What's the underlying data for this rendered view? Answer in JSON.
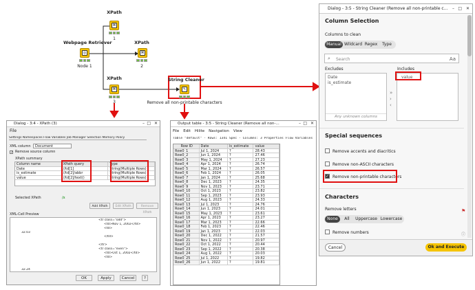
{
  "workflow": {
    "xpath1": {
      "title": "XPath",
      "label": "1"
    },
    "webpage": {
      "title": "Webpage Retriever",
      "label": "Node 1"
    },
    "xpath2": {
      "title": "XPath",
      "label": "2"
    },
    "xpath3": {
      "title": "XPath",
      "label": "3"
    },
    "cleaner": {
      "title": "String Cleaner",
      "label": "Remove all non-printable characters"
    }
  },
  "xpath_dialog": {
    "title": "Dialog - 3:4 - XPath (3)",
    "menu": "File",
    "tabs": "Settings  Namespaces  Flow Variables  Job Manager Selection  Memory Policy",
    "xml_column_label": "XML column",
    "xml_column_value": "Document",
    "remove_source": "Remove source column",
    "summary_label": "XPath summary",
    "headers": [
      "Column name",
      "XPath query",
      "Type"
    ],
    "rows": [
      [
        "Date",
        "//td[1]",
        "String(Multiple Rows)"
      ],
      [
        "is_estimate",
        "//td[2]/abbr",
        "String(Multiple Rows)"
      ],
      [
        "value",
        "//td[2]/text()",
        "String(Multiple Rows)"
      ]
    ],
    "selected_label": "Selected XPath",
    "selected_value": "/x",
    "add_button": "Add XPath",
    "edit_button": "Edit XPath",
    "remove_button": "Remove XPath",
    "preview_label": "XML-Cell Preview",
    "preview_lines": [
      "<tr class=\"odd\">",
      "<td>Nov 1, 2002</td>",
      "<td>",
      "32.03",
      "</td>",
      "</tr>",
      "<tr class=\"even\">",
      "<td>Oct 1, 2002</td>",
      "<td>",
      "32.24"
    ],
    "ok": "OK",
    "apply": "Apply",
    "cancel": "Cancel"
  },
  "output_table": {
    "title": "Output table - 3:5 - String Cleaner (Remove all non-...",
    "menu": [
      "File",
      "Edit",
      "Hilite",
      "Navigation",
      "View"
    ],
    "info": "Table \"default\" - Rows: 1341  Spec - Columns: 3  Properties  Flow Variables",
    "headers": [
      "Row ID",
      "Date",
      "is_estimate",
      "value"
    ],
    "rows": [
      [
        "Row0_1",
        "Jul 1, 2024",
        "?",
        "28.43"
      ],
      [
        "Row0_2",
        "Jun 1, 2024",
        "?",
        "27.46"
      ],
      [
        "Row0_3",
        "May 1, 2024",
        "?",
        "27.23"
      ],
      [
        "Row0_4",
        "Apr 1, 2024",
        "?",
        "26.74"
      ],
      [
        "Row0_5",
        "Mar 1, 2024",
        "?",
        "26.57"
      ],
      [
        "Row0_6",
        "Feb 1, 2024",
        "?",
        "26.05"
      ],
      [
        "Row0_7",
        "Jan 1, 2024",
        "?",
        "25.68"
      ],
      [
        "Row0_8",
        "Dec 1, 2023",
        "?",
        "24.35"
      ],
      [
        "Row0_9",
        "Nov 1, 2023",
        "?",
        "23.71"
      ],
      [
        "Row0_10",
        "Oct 1, 2023",
        "?",
        "23.82"
      ],
      [
        "Row0_11",
        "Sep 1, 2023",
        "?",
        "23.93"
      ],
      [
        "Row0_12",
        "Aug 1, 2023",
        "?",
        "24.33"
      ],
      [
        "Row0_13",
        "Jul 1, 2023",
        "?",
        "24.76"
      ],
      [
        "Row0_14",
        "Jun 1, 2023",
        "?",
        "24.01"
      ],
      [
        "Row0_15",
        "May 1, 2023",
        "?",
        "23.61"
      ],
      [
        "Row0_16",
        "Apr 1, 2023",
        "?",
        "23.27"
      ],
      [
        "Row0_17",
        "Mar 1, 2023",
        "?",
        "22.66"
      ],
      [
        "Row0_18",
        "Feb 1, 2023",
        "?",
        "22.46"
      ],
      [
        "Row0_19",
        "Jan 1, 2023",
        "?",
        "22.03"
      ],
      [
        "Row0_20",
        "Dec 1, 2022",
        "?",
        "21.57"
      ],
      [
        "Row0_21",
        "Nov 1, 2022",
        "?",
        "20.97"
      ],
      [
        "Row0_22",
        "Oct 1, 2022",
        "?",
        "20.44"
      ],
      [
        "Row0_23",
        "Sep 1, 2022",
        "?",
        "20.38"
      ],
      [
        "Row0_24",
        "Aug 1, 2022",
        "?",
        "20.03"
      ],
      [
        "Row0_25",
        "Jul 1, 2022",
        "?",
        "19.82"
      ],
      [
        "Row0_26",
        "Jun 1, 2022",
        "?",
        "19.81"
      ]
    ]
  },
  "cleaner_dialog": {
    "title": "Dialog - 3:5 - String Cleaner (Remove all non-printable c...",
    "section_columns": "Column Selection",
    "columns_to_clean": "Columns to clean",
    "modes": [
      "Manual",
      "Wildcard",
      "Regex",
      "Type"
    ],
    "search_placeholder": "Search",
    "case_toggle": "Aa",
    "excludes_label": "Excludes",
    "excludes": [
      "Date",
      "is_estimate"
    ],
    "includes_label": "Includes",
    "includes": [
      "value"
    ],
    "unknown_columns": "Any unknown columns",
    "section_special": "Special sequences",
    "options": [
      {
        "label": "Remove accents and diacritics",
        "checked": false
      },
      {
        "label": "Remove non-ASCII characters",
        "checked": false
      },
      {
        "label": "Remove non-printable characters",
        "checked": true
      }
    ],
    "section_characters": "Characters",
    "remove_letters": "Remove letters",
    "letter_modes": [
      "None",
      "All",
      "Uppercase",
      "Lowercase"
    ],
    "remove_numbers": "Remove numbers",
    "cancel": "Cancel",
    "ok_execute": "Ok and Execute",
    "accent_color": "#f5c400"
  }
}
